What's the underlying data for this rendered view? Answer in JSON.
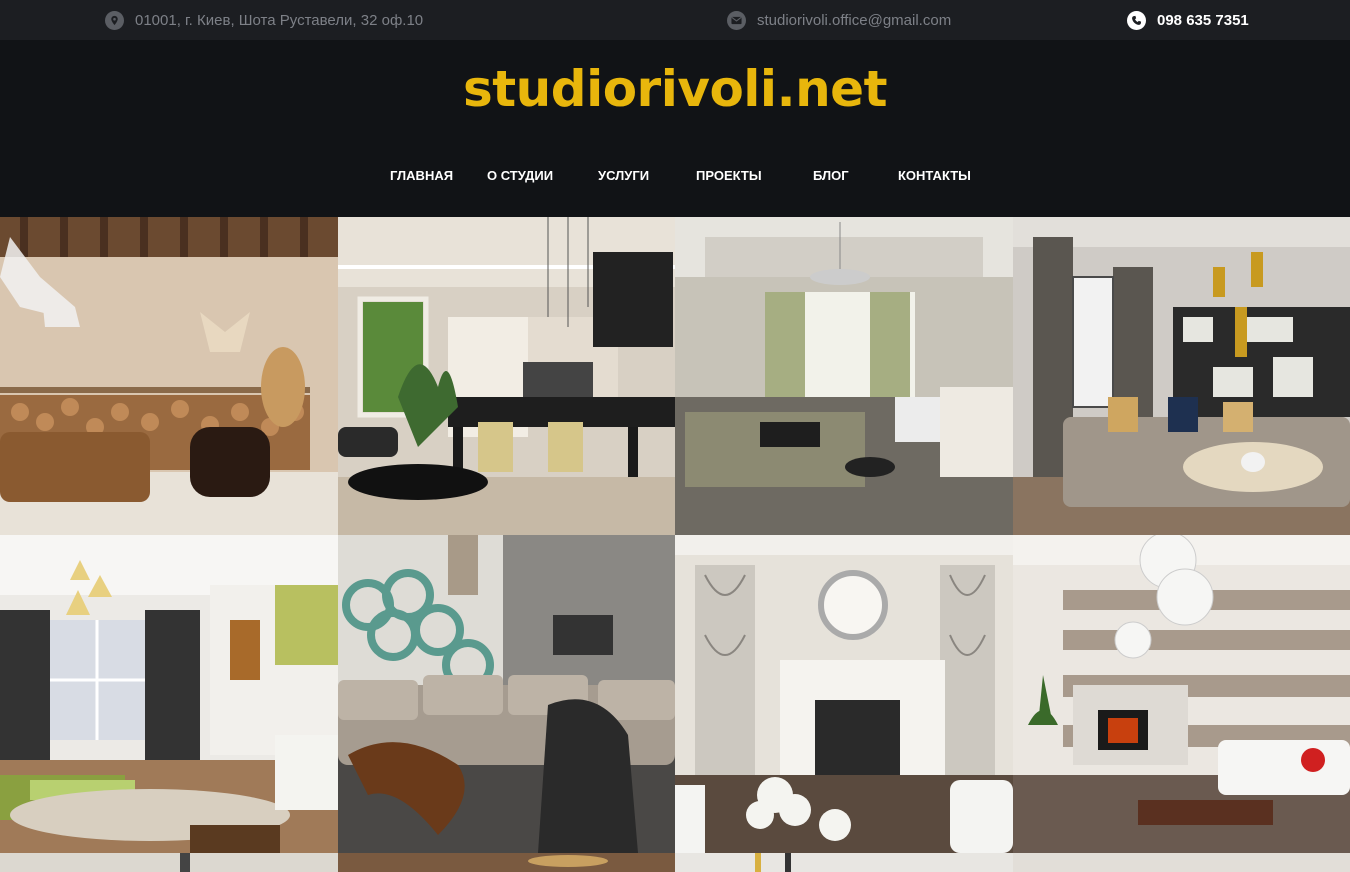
{
  "topbar": {
    "address": "01001, г. Киев, Шота Руставели, 32 оф.10",
    "email": "studiorivoli.office@gmail.com",
    "phone": "098 635 7351",
    "icons": [
      "location-pin-icon",
      "envelope-icon",
      "phone-icon"
    ]
  },
  "header": {
    "logo": "studiorivoli.net",
    "accent_color": "#e8b60c"
  },
  "nav": {
    "items": [
      {
        "label": "ГЛАВНАЯ"
      },
      {
        "label": "О СТУДИИ"
      },
      {
        "label": "УСЛУГИ"
      },
      {
        "label": "ПРОЕКТЫ"
      },
      {
        "label": "БЛОГ"
      },
      {
        "label": "КОНТАКТЫ"
      }
    ]
  },
  "gallery": {
    "tiles": [
      {
        "name": "rustic-living-room-photo"
      },
      {
        "name": "modern-kitchen-dining-photo"
      },
      {
        "name": "classic-bedroom-photo"
      },
      {
        "name": "living-room-pendant-lamps-photo"
      },
      {
        "name": "bright-living-room-photo"
      },
      {
        "name": "lounge-sofa-shelves-photo"
      },
      {
        "name": "white-fireplace-hall-photo"
      },
      {
        "name": "striped-wall-living-room-photo"
      },
      {
        "name": "partial-photo-1"
      },
      {
        "name": "partial-photo-2"
      },
      {
        "name": "partial-photo-3"
      },
      {
        "name": "partial-photo-4"
      }
    ]
  }
}
